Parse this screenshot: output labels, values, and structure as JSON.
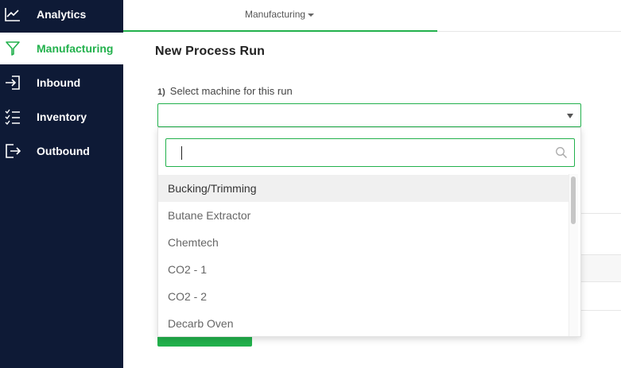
{
  "sidebar": {
    "items": [
      {
        "label": "Analytics",
        "icon": "line-chart-icon",
        "active": false
      },
      {
        "label": "Manufacturing",
        "icon": "funnel-icon",
        "active": true
      },
      {
        "label": "Inbound",
        "icon": "sign-in-icon",
        "active": false
      },
      {
        "label": "Inventory",
        "icon": "checklist-icon",
        "active": false
      },
      {
        "label": "Outbound",
        "icon": "sign-out-icon",
        "active": false
      }
    ]
  },
  "topbar": {
    "tab_label": "Manufacturing"
  },
  "main": {
    "title": "New Process Run",
    "step": {
      "number": "1)",
      "label": "Select machine for this run"
    }
  },
  "dropdown": {
    "search_value": "",
    "options": [
      "Bucking/Trimming",
      "Butane Extractor",
      "Chemtech",
      "CO2 - 1",
      "CO2 - 2",
      "Decarb Oven"
    ],
    "highlighted_index": 0
  },
  "colors": {
    "accent": "#22b14c",
    "sidebar_bg": "#0e1a36"
  }
}
